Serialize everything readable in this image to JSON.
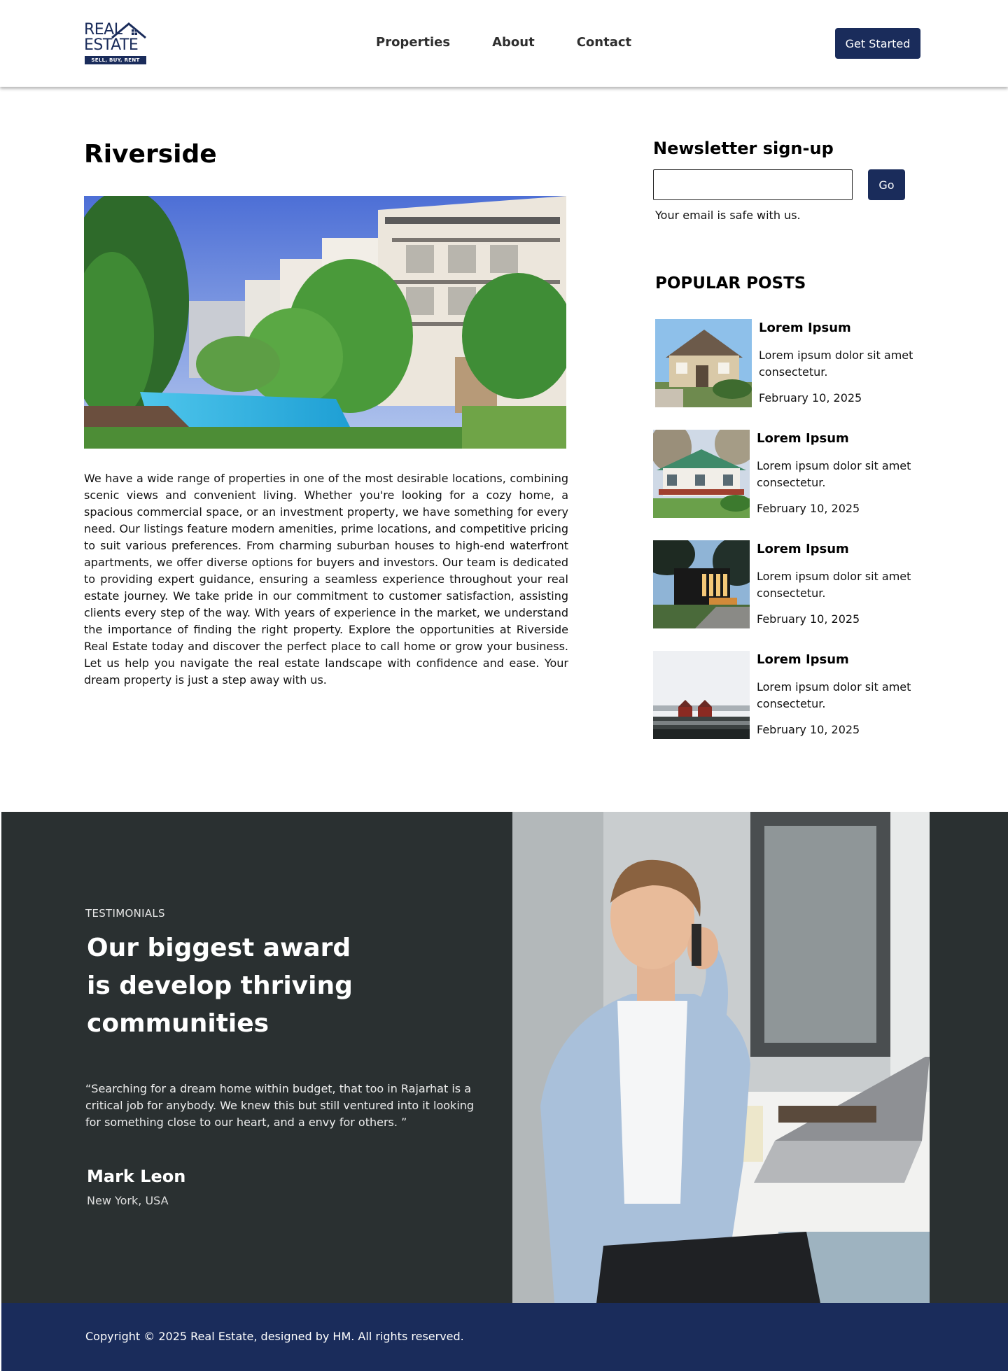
{
  "header": {
    "logo": {
      "line1": "REAL",
      "line2": "ESTATE",
      "tagline": "SELL, BUY, RENT"
    },
    "nav": [
      {
        "label": "Properties"
      },
      {
        "label": "About"
      },
      {
        "label": "Contact"
      }
    ],
    "cta_label": "Get Started"
  },
  "main": {
    "title": "Riverside",
    "body": "We have a wide range of properties in one of the most desirable locations, combining scenic views and convenient living. Whether you're looking for a cozy home, a spacious commercial space, or an investment property, we have something for every need. Our listings feature modern amenities, prime locations, and competitive pricing to suit various preferences. From charming suburban houses to high-end waterfront apartments, we offer diverse options for buyers and investors. Our team is dedicated to providing expert guidance, ensuring a seamless experience throughout your real estate journey. We take pride in our commitment to customer satisfaction, assisting clients every step of the way. With years of experience in the market, we understand the importance of finding the right property. Explore the opportunities at Riverside Real Estate today and discover the perfect place to call home or grow your business. Let us help you navigate the real estate landscape with confidence and ease. Your dream property is just a step away with us."
  },
  "sidebar": {
    "newsletter": {
      "title": "Newsletter sign-up",
      "input_value": "",
      "button_label": "Go",
      "note": "Your email is safe with us."
    },
    "popular_title": "POPULAR POSTS",
    "posts": [
      {
        "title": "Lorem Ipsum",
        "text": "Lorem ipsum dolor sit amet consectetur.",
        "date": "February 10, 2025"
      },
      {
        "title": "Lorem Ipsum",
        "text": "Lorem ipsum dolor sit amet consectetur.",
        "date": "February 10, 2025"
      },
      {
        "title": "Lorem Ipsum",
        "text": "Lorem ipsum dolor sit amet consectetur.",
        "date": "February 10, 2025"
      },
      {
        "title": "Lorem Ipsum",
        "text": "Lorem ipsum dolor sit amet consectetur.",
        "date": "February 10, 2025"
      }
    ]
  },
  "testimonials": {
    "label": "TESTIMONIALS",
    "heading": "Our biggest award is develop thriving communities",
    "quote": "“Searching for a dream home within budget, that too in Rajarhat is a critical job for anybody. We knew this but still ventured into it looking for something close to our heart, and a envy for others. ”",
    "name": "Mark Leon",
    "location": "New York, USA"
  },
  "footer": {
    "copyright": "Copyright © 2025 Real Estate, designed by HM. All rights reserved."
  },
  "colors": {
    "brand_navy": "#1a2c5b",
    "testimonial_bg": "#2a3031"
  }
}
